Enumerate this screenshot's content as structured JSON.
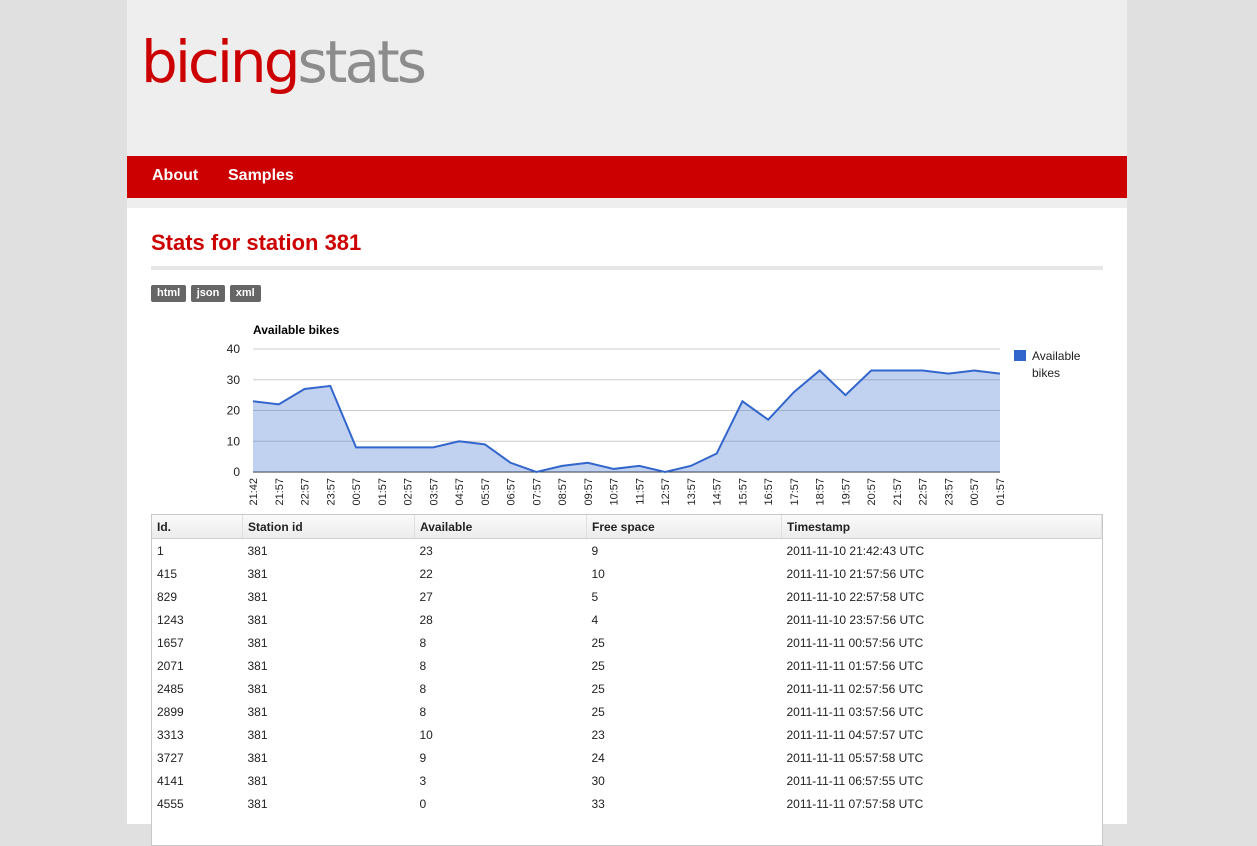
{
  "brand": {
    "part1": "bicing",
    "part2": "stats"
  },
  "nav": [
    {
      "label": "About"
    },
    {
      "label": "Samples"
    }
  ],
  "page_title": "Stats for station 381",
  "formats": [
    {
      "label": "html"
    },
    {
      "label": "json"
    },
    {
      "label": "xml"
    }
  ],
  "chart_data": {
    "type": "area",
    "title": "Available bikes",
    "xlabel": "",
    "ylabel": "",
    "ylim": [
      0,
      40
    ],
    "yticks": [
      0,
      10,
      20,
      30,
      40
    ],
    "grid": true,
    "legend_position": "right",
    "categories": [
      "21:42",
      "21:57",
      "22:57",
      "23:57",
      "00:57",
      "01:57",
      "02:57",
      "03:57",
      "04:57",
      "05:57",
      "06:57",
      "07:57",
      "08:57",
      "09:57",
      "10:57",
      "11:57",
      "12:57",
      "13:57",
      "14:57",
      "15:57",
      "16:57",
      "17:57",
      "18:57",
      "19:57",
      "20:57",
      "21:57",
      "22:57",
      "23:57",
      "00:57",
      "01:57"
    ],
    "series": [
      {
        "name": "Available bikes",
        "color": "#3366cc",
        "values": [
          23,
          22,
          27,
          28,
          8,
          8,
          8,
          8,
          10,
          9,
          3,
          0,
          2,
          3,
          1,
          2,
          0,
          2,
          6,
          23,
          17,
          26,
          33,
          25,
          33,
          33,
          33,
          32,
          33,
          32
        ]
      }
    ]
  },
  "table": {
    "headers": [
      "Id.",
      "Station id",
      "Available",
      "Free space",
      "Timestamp"
    ],
    "rows": [
      [
        "1",
        "381",
        "23",
        "9",
        "2011-11-10 21:42:43 UTC"
      ],
      [
        "415",
        "381",
        "22",
        "10",
        "2011-11-10 21:57:56 UTC"
      ],
      [
        "829",
        "381",
        "27",
        "5",
        "2011-11-10 22:57:58 UTC"
      ],
      [
        "1243",
        "381",
        "28",
        "4",
        "2011-11-10 23:57:56 UTC"
      ],
      [
        "1657",
        "381",
        "8",
        "25",
        "2011-11-11 00:57:56 UTC"
      ],
      [
        "2071",
        "381",
        "8",
        "25",
        "2011-11-11 01:57:56 UTC"
      ],
      [
        "2485",
        "381",
        "8",
        "25",
        "2011-11-11 02:57:56 UTC"
      ],
      [
        "2899",
        "381",
        "8",
        "25",
        "2011-11-11 03:57:56 UTC"
      ],
      [
        "3313",
        "381",
        "10",
        "23",
        "2011-11-11 04:57:57 UTC"
      ],
      [
        "3727",
        "381",
        "9",
        "24",
        "2011-11-11 05:57:58 UTC"
      ],
      [
        "4141",
        "381",
        "3",
        "30",
        "2011-11-11 06:57:55 UTC"
      ],
      [
        "4555",
        "381",
        "0",
        "33",
        "2011-11-11 07:57:58 UTC"
      ]
    ]
  }
}
